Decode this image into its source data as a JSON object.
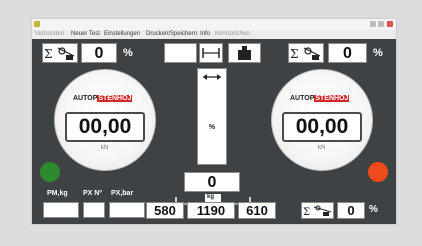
{
  "menu": {
    "items": [
      {
        "label": "Verbunden",
        "disabled": true
      },
      {
        "label": "Neuer Test",
        "disabled": false
      },
      {
        "label": "Einstellungen",
        "disabled": false
      },
      {
        "label": "Drucken/Speichern",
        "disabled": false
      },
      {
        "label": "Info",
        "disabled": false
      },
      {
        "label": "Kennzeichen",
        "disabled": true
      }
    ]
  },
  "left": {
    "sum_value": "0",
    "sum_unit": "%",
    "gauge": {
      "brand_a": "AUTOP",
      "brand_b": "STENHOJ",
      "value": "00,00",
      "unit": "kN"
    },
    "lamp_color": "#2b8a2b"
  },
  "right": {
    "sum_value": "0",
    "sum_unit": "%",
    "gauge": {
      "brand_a": "AUTOP",
      "brand_b": "STENHOJ",
      "value": "00,00",
      "unit": "kN"
    },
    "lamp_color": "#ee4a1c"
  },
  "center": {
    "bar_unit": "%",
    "diff_value": "0",
    "axle_unit": "kg"
  },
  "bottom": {
    "labels": {
      "pm": "PM,kg",
      "px_no": "PX Nº",
      "px_bar": "PX,bar"
    },
    "axle_left": "580",
    "axle_total": "1190",
    "axle_right": "610",
    "brake_value": "0",
    "brake_unit": "%"
  },
  "colors": {
    "background": "#3f4244",
    "brand_red": "#d3272a"
  }
}
